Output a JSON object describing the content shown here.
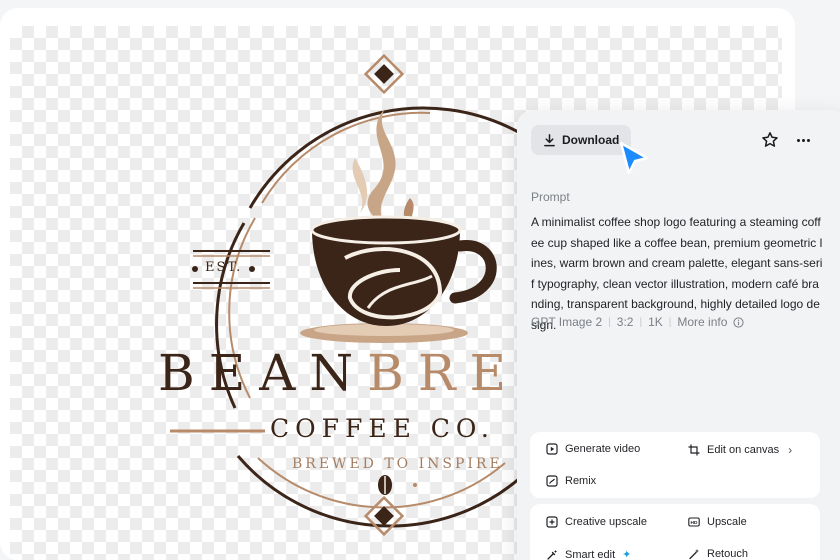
{
  "logo": {
    "brand_dark": "BEAN",
    "brand_light": "BRE",
    "subtitle": "COFFEE CO.",
    "tagline": "BREWED TO INSPIRE",
    "est": "EST.",
    "colors": {
      "dark_brown": "#3b2418",
      "tan": "#b78b6a",
      "cream": "#d9b99b"
    }
  },
  "panel": {
    "download_label": "Download",
    "star_icon": "star-icon",
    "more_icon": "more-horizontal-icon",
    "prompt_label": "Prompt",
    "prompt_text": "A minimalist coffee shop logo featuring a steaming coffee cup shaped like a coffee bean, premium geometric lines, warm brown and cream palette, elegant sans-serif typography, clean vector illustration, modern café branding, transparent background, highly detailed logo design.",
    "meta": {
      "model": "GPT Image 2",
      "ratio": "3:2",
      "resolution": "1K",
      "more_info": "More info"
    },
    "actions_primary": [
      {
        "label": "Generate video",
        "icon": "play-square-icon"
      },
      {
        "label": "Edit on canvas",
        "icon": "crop-icon"
      },
      {
        "label": "Remix",
        "icon": "remix-icon"
      }
    ],
    "actions_secondary": [
      {
        "label": "Creative upscale",
        "icon": "creative-upscale-icon"
      },
      {
        "label": "Upscale",
        "icon": "hd-icon"
      },
      {
        "label": "Smart edit",
        "icon": "magic-brush-icon"
      },
      {
        "label": "Retouch",
        "icon": "wand-icon"
      }
    ]
  }
}
